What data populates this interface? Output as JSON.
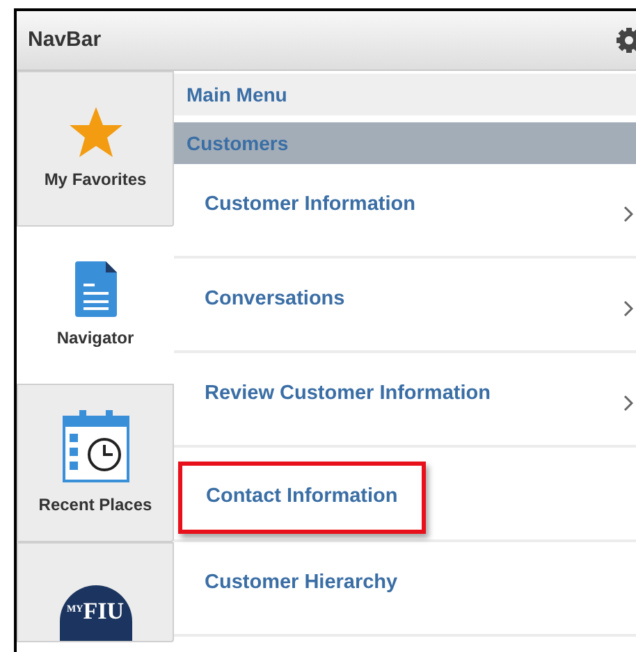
{
  "header": {
    "title": "NavBar"
  },
  "tabs": [
    {
      "label": "My Favorites",
      "kind": "star",
      "selected": false
    },
    {
      "label": "Navigator",
      "kind": "document",
      "selected": true
    },
    {
      "label": "Recent Places",
      "kind": "calendar",
      "selected": false
    },
    {
      "kind": "logo",
      "logo_small": "MY",
      "logo_main": "FIU",
      "selected": false
    }
  ],
  "breadcrumbs": [
    {
      "label": "Main Menu",
      "selected": false
    },
    {
      "label": "Customers",
      "selected": true
    }
  ],
  "menu_items": [
    {
      "label": "Customer Information",
      "has_children": true,
      "highlighted": false
    },
    {
      "label": "Conversations",
      "has_children": true,
      "highlighted": false
    },
    {
      "label": "Review Customer Information",
      "has_children": true,
      "highlighted": false
    },
    {
      "label": "Contact Information",
      "has_children": false,
      "highlighted": true
    },
    {
      "label": "Customer Hierarchy",
      "has_children": false,
      "highlighted": false
    }
  ]
}
